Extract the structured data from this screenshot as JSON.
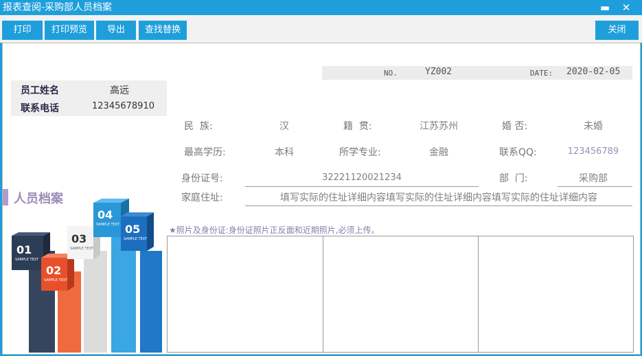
{
  "window": {
    "title": "报表查阅-采购部人员档案",
    "minimize": "▬",
    "close": "✕"
  },
  "toolbar": {
    "print": "打印",
    "print_preview": "打印预览",
    "export": "导出",
    "find_replace": "查找替换",
    "close": "关闭"
  },
  "header": {
    "no_label": "NO.",
    "no_value": "YZ002",
    "date_label": "DATE:",
    "date_value": "2020-02-05"
  },
  "employee": {
    "name_label": "员工姓名",
    "name_value": "高远",
    "phone_label": "联系电话",
    "phone_value": "12345678910"
  },
  "fields": {
    "ethnicity_label": "民  族:",
    "ethnicity_value": "汉",
    "origin_label": "籍  贯:",
    "origin_value": "江苏苏州",
    "marital_label": "婚 否:",
    "marital_value": "未婚",
    "education_label": "最高学历:",
    "education_value": "本科",
    "major_label": "所学专业:",
    "major_value": "金融",
    "qq_label": "联系QQ:",
    "qq_value": "123456789",
    "id_label": "身份证号:",
    "id_value": "32221120021234",
    "dept_label": "部  门:",
    "dept_value": "采购部",
    "address_label": "家庭住址:",
    "address_value": "填写实际的住址详细内容填写实际的住址详细内容填写实际的住址详细内容"
  },
  "section": {
    "title": "人员档案",
    "photo_note": "★照片及身份证:身份证照片正反面和近期照片,必须上传。"
  },
  "infographic": {
    "items": [
      {
        "num": "01",
        "caption": "SAMPLE TEXT",
        "color": "#2c3e55"
      },
      {
        "num": "02",
        "caption": "SAMPLE TEXT",
        "color": "#e8502c"
      },
      {
        "num": "03",
        "caption": "SAMPLE TEXT",
        "color": "#f0f0f0"
      },
      {
        "num": "04",
        "caption": "SAMPLE TEXT",
        "color": "#2a97d8"
      },
      {
        "num": "05",
        "caption": "SAMPLE TEXT",
        "color": "#1c6fc0"
      }
    ]
  }
}
